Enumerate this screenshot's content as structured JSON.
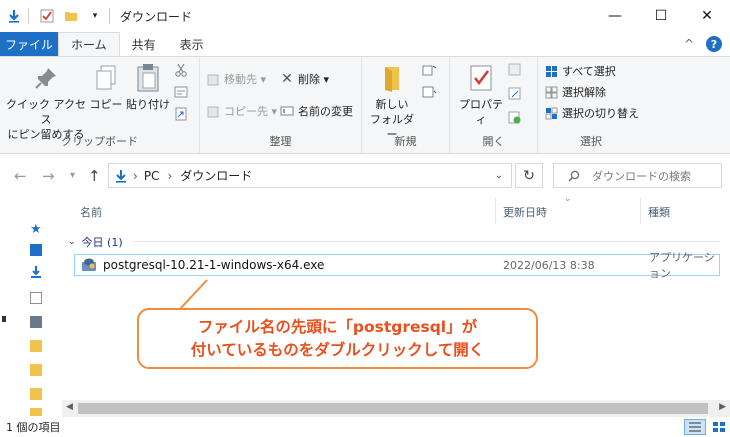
{
  "window": {
    "title": "ダウンロード",
    "minimize": "—",
    "maximize": "☐",
    "close": "✕"
  },
  "ribbon_tabs": {
    "file": "ファイル",
    "home": "ホーム",
    "share": "共有",
    "view": "表示"
  },
  "clipboard": {
    "pin": [
      "クイック アクセス",
      "にピン留めする"
    ],
    "copy": "コピー",
    "paste": "貼り付け",
    "label": "クリップボード"
  },
  "organize": {
    "move_to": "移動先 ▾",
    "copy_to": "コピー先 ▾",
    "delete": "削除 ▾",
    "rename": "名前の変更",
    "label": "整理"
  },
  "new": {
    "new_folder": [
      "新しい",
      "フォルダー"
    ],
    "label": "新規"
  },
  "open": {
    "properties": "プロパティ",
    "label": "開く"
  },
  "select": {
    "select_all": "すべて選択",
    "select_none": "選択解除",
    "invert": "選択の切り替え",
    "label": "選択"
  },
  "address": {
    "crumbs": [
      "PC",
      "ダウンロード"
    ],
    "search_placeholder": "ダウンロードの検索"
  },
  "columns": {
    "name": "名前",
    "date": "更新日時",
    "type": "種類"
  },
  "group": {
    "label": "今日 (1)"
  },
  "files": [
    {
      "name": "postgresql-10.21-1-windows-x64.exe",
      "date": "2022/06/13 8:38",
      "type": "アプリケーション"
    }
  ],
  "status": {
    "count": "1 個の項目"
  },
  "callout": {
    "line1": "ファイル名の先頭に「postgresql」が",
    "line2": "付いているものをダブルクリックして開く"
  },
  "colors": {
    "accent": "#1e6fc6",
    "callout": "#e8501e"
  }
}
